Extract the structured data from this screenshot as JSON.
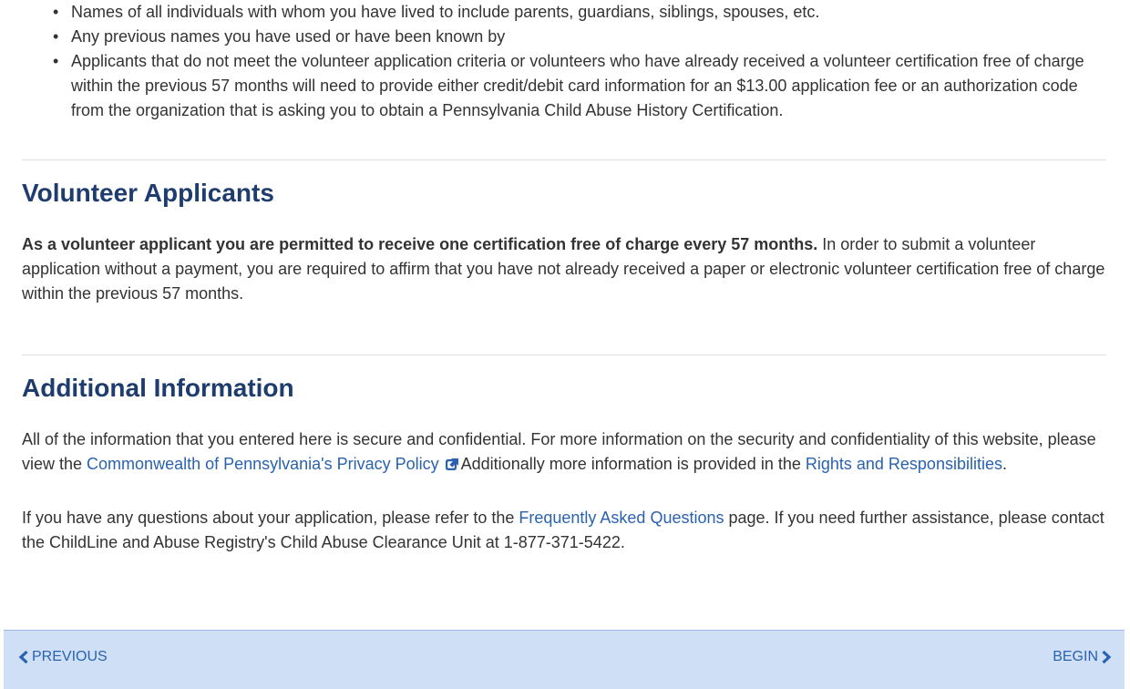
{
  "requirements": {
    "items": [
      "Names of all individuals with whom you have lived to include parents, guardians, siblings, spouses, etc.",
      "Any previous names you have used or have been known by",
      "Applicants that do not meet the volunteer application criteria or volunteers who have already received a volunteer certification free of charge within the previous 57 months will need to provide either credit/debit card information for an $13.00 application fee or an authorization code from the organization that is asking you to obtain a Pennsylvania Child Abuse History Certification."
    ]
  },
  "volunteer": {
    "heading": "Volunteer Applicants",
    "bold_text": "As a volunteer applicant you are permitted to receive one certification free of charge every 57 months.",
    "text": " In order to submit a volunteer application without a payment, you are required to affirm that you have not already received a paper or electronic volunteer certification free of charge within the previous 57 months."
  },
  "additional": {
    "heading": "Additional Information",
    "p1_text1": "All of the information that you entered here is secure and confidential. For more information on the security and confidentiality of this website, please view the ",
    "privacy_link": "Commonwealth of Pennsylvania's Privacy Policy",
    "p1_text2": "Additionally more information is provided in the ",
    "rights_link": "Rights and Responsibilities",
    "p1_text3": ".",
    "p2_text1": "If you have any questions about your application, please refer to the ",
    "faq_link": "Frequently Asked Questions",
    "p2_text2": " page. If you need further assistance, please contact the ChildLine and Abuse Registry's Child Abuse Clearance Unit at 1-877-371-5422."
  },
  "footer": {
    "previous_label": "PREVIOUS",
    "begin_label": "BEGIN"
  },
  "colors": {
    "heading": "#1f3c6e",
    "link": "#2a62b0",
    "footer_bg": "#cfe0f6"
  },
  "icons": {
    "external_link": "external-link-icon",
    "previous": "chevron-left-icon",
    "begin": "chevron-right-icon"
  }
}
